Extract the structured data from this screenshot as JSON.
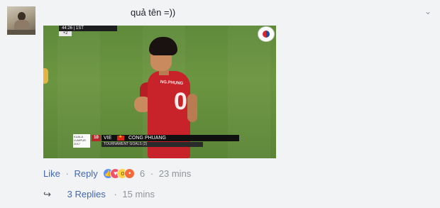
{
  "comment": {
    "text": "quả tên =))",
    "actions": {
      "like_label": "Like",
      "reply_label": "Reply",
      "separator": "·",
      "reaction_count": "6",
      "timestamp": "23 mins"
    },
    "reactions": [
      "like-icon",
      "love-icon",
      "wow-icon",
      "angry-icon"
    ],
    "replies": {
      "label": "3 Replies",
      "timestamp": "15 mins"
    }
  },
  "photo": {
    "scoreboard_time": "44:26 | 1ST",
    "scoreboard_sub": "+2",
    "jersey_name": "NG.PHUNG",
    "jersey_number": "0",
    "lower_third": {
      "logo_text": "KUALA LUMPUR 2017",
      "player_number": "10",
      "team_code": "VIE",
      "player_name": "CONG PHUANG",
      "subtitle": "TOURNAMENT GOALS (2)"
    }
  },
  "colors": {
    "link": "#4267b2",
    "meta": "#90949c",
    "background": "#f2f3f5"
  }
}
